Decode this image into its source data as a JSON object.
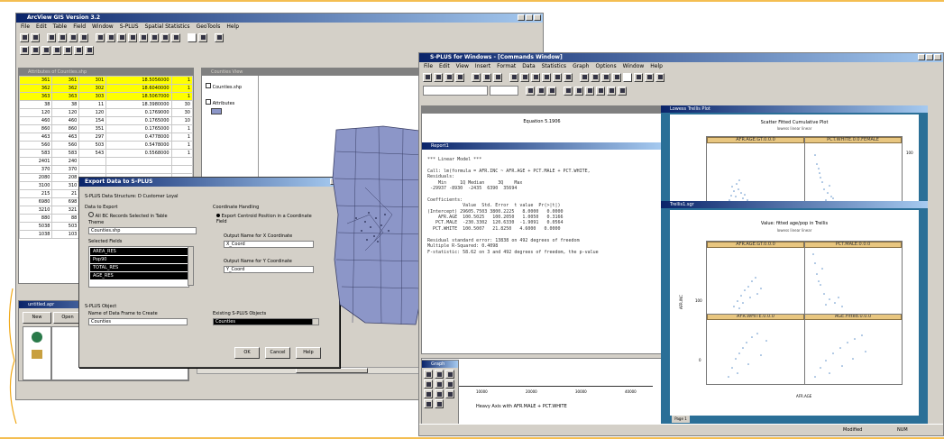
{
  "colors": {
    "accent": "#f0a818",
    "titlebar": "#0a246a",
    "highlight": "#ffff00",
    "map": "#8c96c8",
    "plotframe": "#2a6f97",
    "strip": "#e8c680",
    "points": "#5b8fc8"
  },
  "left_app": {
    "title": "ArcView GIS Version 3.2",
    "menu": [
      "File",
      "Edit",
      "Table",
      "Field",
      "Window",
      "S-PLUS",
      "Spatial Statistics",
      "GeoTools",
      "Help"
    ],
    "table_panel": {
      "title": "Attributes of Counties.shp",
      "rows": [
        [
          "361",
          "361",
          "301",
          "18.5056000",
          "1"
        ],
        [
          "362",
          "362",
          "302",
          "18.6040000",
          "1"
        ],
        [
          "363",
          "363",
          "303",
          "18.5067000",
          "1"
        ],
        [
          "38",
          "38",
          "11",
          "18.3980000",
          "30"
        ],
        [
          "120",
          "120",
          "120",
          "0.1769000",
          "30"
        ],
        [
          "460",
          "460",
          "154",
          "0.1765000",
          "10"
        ],
        [
          "860",
          "860",
          "351",
          "0.1765000",
          "1"
        ],
        [
          "463",
          "463",
          "297",
          "0.4778000",
          "1"
        ],
        [
          "560",
          "560",
          "503",
          "0.5478000",
          "1"
        ],
        [
          "583",
          "583",
          "543",
          "0.5568000",
          "1"
        ],
        [
          "2401",
          "240",
          "",
          "",
          ""
        ],
        [
          "370",
          "370",
          "",
          "",
          ""
        ],
        [
          "2080",
          "208",
          "",
          "",
          ""
        ],
        [
          "3100",
          "310",
          "",
          "",
          ""
        ],
        [
          "215",
          "21",
          "",
          "",
          ""
        ],
        [
          "6980",
          "698",
          "",
          "",
          ""
        ],
        [
          "3210",
          "321",
          "",
          "",
          ""
        ],
        [
          "880",
          "88",
          "",
          "",
          ""
        ],
        [
          "5038",
          "503",
          "",
          "",
          ""
        ],
        [
          "1038",
          "103",
          "",
          "",
          ""
        ]
      ]
    },
    "legend_panel": {
      "title": "Counties View",
      "item1": "Counties.shp",
      "item2": "Attributes"
    },
    "project_panel": {
      "title": "untitled.apr",
      "btn_new": "New",
      "btn_open": "Open",
      "icons": [
        "Views",
        "Tables"
      ]
    },
    "dialog": {
      "title": "Export Data to S-PLUS",
      "subtitle": "S-PLUS Data Structure: D Customer Loyal",
      "data_export_label": "Data to Export",
      "opt_all": "All BC Records Selected in Table",
      "opt_theme": "Theme",
      "theme_value": "Counties.shp",
      "selected_fields_label": "Selected Fields",
      "fields": [
        "AREA_RES",
        "Pop90",
        "TOTAL_RES",
        "AGE_RES"
      ],
      "coord_label": "Coordinate Handling",
      "coord_opt": "Export Centroid Position in a Coordinate Field",
      "x_label": "Output Name for X Coordinate",
      "x_value": "X_Coord",
      "y_label": "Output Name for Y Coordinate",
      "y_value": "Y_Coord",
      "splus_label": "S-PLUS Object",
      "name_label": "Name of Data Frame to Create",
      "name_value": "Counties",
      "existing_label": "Existing S-PLUS Objects",
      "existing_value": "Counties",
      "ok": "OK",
      "cancel": "Cancel",
      "help": "Help"
    }
  },
  "right_app": {
    "title": "S-PLUS for Windows - [Commands Window]",
    "menu": [
      "File",
      "Edit",
      "View",
      "Insert",
      "Format",
      "Data",
      "Statistics",
      "Graph",
      "Options",
      "Window",
      "Help"
    ],
    "report_title": "Report1",
    "report_header": "Equation 5.1906",
    "regression": [
      "*** Linear Model ***",
      "",
      "Call: lm(formula = AFR.INC ~ AFR.AGE + PCT.MALE + PCT.WHITE,",
      "Residuals:",
      "    Min     1Q Median     3Q    Max",
      " -29937 -8930  -2435  6390  35694",
      "",
      "Coefficients:",
      "             Value  Std. Error  t value  Pr(>|t|)",
      "(Intercept) 29605.7503 3800.2225   8.0000   0.0000",
      "    AFR.AGE  100.5025   100.2050   1.0050   0.3166",
      "   PCT.MALE  -230.3302  120.6330  -1.9091   0.0564",
      "  PCT.WHITE  100.5007   21.8250   4.6000   0.0000",
      "",
      "Residual standard error: 13838 on 492 degrees of freedom",
      "Multiple R-Squared: 0.4098",
      "F-statistic: 58.62 on 3 and 492 degrees of freedom, the p-value"
    ],
    "graph1": {
      "title": "Lowess Trellis Plot",
      "heading": "Scatter Fitted Cumulative Plot",
      "legend": "lowess    linear    linear",
      "strips": [
        "AFR.AGE.GT.0.0.0",
        "PCT.WHITE.0.0.FEMALE"
      ],
      "ytick": "100"
    },
    "graph2": {
      "title": "Trellis1.sgr",
      "heading": "Value: fitted age/pop in Trellis",
      "legend": "lowess    linear    linear",
      "strips_top": [
        "AFR.AGE.GT.0.0.0",
        "PCT.MALE.0.0.0"
      ],
      "strips_bottom": [
        "AFR.WHITE.0.0.0",
        "AGE.Fitted.0.0.0"
      ],
      "yaxis": "AFR.INC",
      "xaxis": "AFR.AGE",
      "ytick_hi": "100",
      "ytick_lo": "0",
      "tab": "Page 1"
    },
    "bottom_axis_label": "Heavy Axis with AFR.MALE + PCT.WHITE",
    "bottom_ticks": [
      "10000",
      "20000",
      "30000",
      "40000"
    ],
    "palette_title": "Graph",
    "status": {
      "left": "Modified",
      "right": "NUM"
    }
  }
}
